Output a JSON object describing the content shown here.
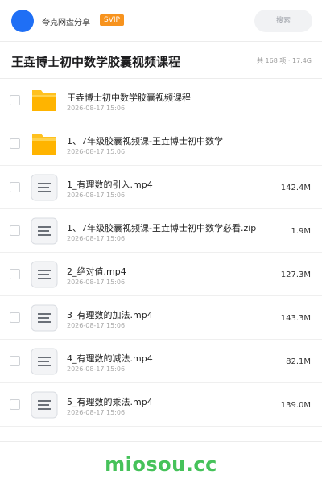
{
  "header": {
    "brand": "夸克网盘分享",
    "badge": "SVIP",
    "search_label": "搜索"
  },
  "folder": {
    "title": "王垚博士初中数学胶囊视频课程",
    "meta": "共 168 项 · 17.4G"
  },
  "colors": {
    "accent": "#1f6ff5",
    "badge": "#f7931e",
    "folder": "#ffc11f",
    "watermark": "#46c25a"
  },
  "files": [
    {
      "name": "王垚博士初中数学胶囊视频课程",
      "date": "2026-08-17 15:06",
      "size": "",
      "icon": "folder-icon"
    },
    {
      "name": "1、7年级胶囊视频课-王垚博士初中数学",
      "date": "2026-08-17 15:06",
      "size": "",
      "icon": "folder-icon"
    },
    {
      "name": "1_有理数的引入.mp4",
      "date": "2026-08-17 15:06",
      "size": "142.4M",
      "icon": "document-icon"
    },
    {
      "name": "1、7年级胶囊视频课-王垚博士初中数学必看.zip",
      "date": "2026-08-17 15:06",
      "size": "1.9M",
      "icon": "document-icon"
    },
    {
      "name": "2_绝对值.mp4",
      "date": "2026-08-17 15:06",
      "size": "127.3M",
      "icon": "document-icon"
    },
    {
      "name": "3_有理数的加法.mp4",
      "date": "2026-08-17 15:06",
      "size": "143.3M",
      "icon": "document-icon"
    },
    {
      "name": "4_有理数的减法.mp4",
      "date": "2026-08-17 15:06",
      "size": "82.1M",
      "icon": "document-icon"
    },
    {
      "name": "5_有理数的乘法.mp4",
      "date": "2026-08-17 15:06",
      "size": "139.0M",
      "icon": "document-icon"
    }
  ],
  "footer": {
    "watermark": "miosou.cc"
  }
}
